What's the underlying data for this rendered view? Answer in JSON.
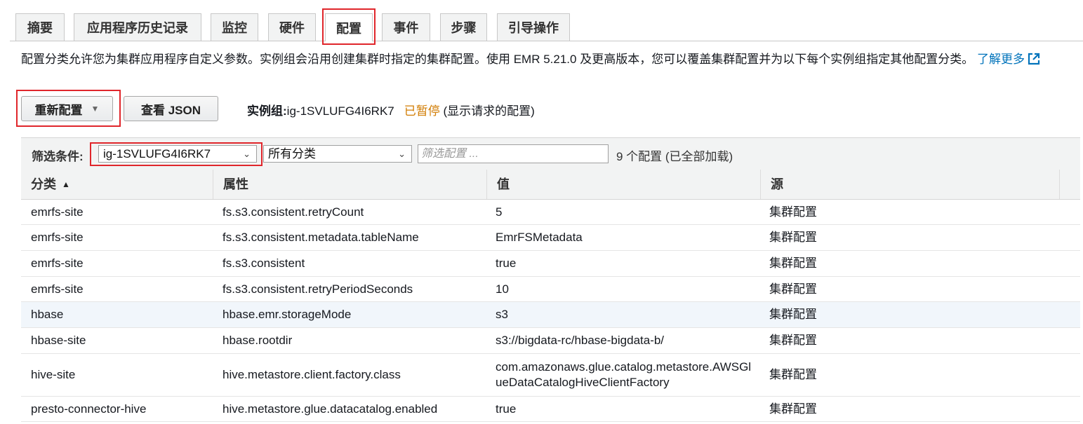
{
  "tabs": [
    {
      "label": "摘要"
    },
    {
      "label": "应用程序历史记录"
    },
    {
      "label": "监控"
    },
    {
      "label": "硬件"
    },
    {
      "label": "配置"
    },
    {
      "label": "事件"
    },
    {
      "label": "步骤"
    },
    {
      "label": "引导操作"
    }
  ],
  "active_tab": "配置",
  "description": {
    "text": "配置分类允许您为集群应用程序自定义参数。实例组会沿用创建集群时指定的集群配置。使用 EMR 5.21.0 及更高版本，您可以覆盖集群配置并为以下每个实例组指定其他配置分类。",
    "learn_more": "了解更多"
  },
  "toolbar": {
    "reconfigure_label": "重新配置",
    "view_json_label": "查看 JSON",
    "instance_group_prefix": "实例组:",
    "instance_group_id": "ig-1SVLUFG4I6RK7",
    "status": "已暂停",
    "status_note": "(显示请求的配置)"
  },
  "filter": {
    "label": "筛选条件:",
    "instance_group_select": "ig-1SVLUFG4I6RK7",
    "category_select": "所有分类",
    "search_placeholder": "筛选配置 ...",
    "count_text": "9 个配置 (已全部加载)"
  },
  "table": {
    "headers": [
      "分类",
      "属性",
      "值",
      "源"
    ],
    "rows": [
      {
        "classification": "emrfs-site",
        "property": "fs.s3.consistent.retryCount",
        "value": "5",
        "source": "集群配置"
      },
      {
        "classification": "emrfs-site",
        "property": "fs.s3.consistent.metadata.tableName",
        "value": "EmrFSMetadata",
        "source": "集群配置"
      },
      {
        "classification": "emrfs-site",
        "property": "fs.s3.consistent",
        "value": "true",
        "source": "集群配置"
      },
      {
        "classification": "emrfs-site",
        "property": "fs.s3.consistent.retryPeriodSeconds",
        "value": "10",
        "source": "集群配置"
      },
      {
        "classification": "hbase",
        "property": "hbase.emr.storageMode",
        "value": "s3",
        "source": "集群配置"
      },
      {
        "classification": "hbase-site",
        "property": "hbase.rootdir",
        "value": "s3://bigdata-rc/hbase-bigdata-b/",
        "source": "集群配置"
      },
      {
        "classification": "hive-site",
        "property": "hive.metastore.client.factory.class",
        "value": "com.amazonaws.glue.catalog.metastore.AWSGlueDataCatalogHiveClientFactory",
        "source": "集群配置"
      },
      {
        "classification": "presto-connector-hive",
        "property": "hive.metastore.glue.datacatalog.enabled",
        "value": "true",
        "source": "集群配置"
      }
    ]
  },
  "colors": {
    "link": "#0073bb",
    "status_paused": "#d17b00",
    "highlight_box": "#e0262b",
    "row_hover": "#f1f6fb"
  }
}
